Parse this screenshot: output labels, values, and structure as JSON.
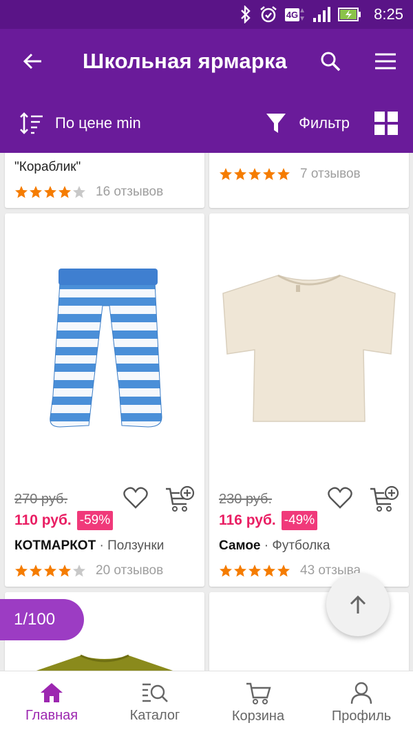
{
  "status_bar": {
    "time": "8:25",
    "network": "4G"
  },
  "app_bar": {
    "title": "Школьная ярмарка"
  },
  "sort_bar": {
    "sort_label": "По цене min",
    "filter_label": "Фильтр"
  },
  "products_partial": [
    {
      "title_line2": "\"Кораблик\"",
      "rating": 4,
      "reviews": "16 отзывов"
    },
    {
      "rating": 5,
      "reviews": "7 отзывов"
    }
  ],
  "products": [
    {
      "old_price": "270 руб.",
      "price": "110 руб.",
      "discount": "-59%",
      "brand": "КОТМАРКОТ",
      "category": "Ползунки",
      "rating": 4,
      "reviews": "20 отзывов"
    },
    {
      "old_price": "230 руб.",
      "price": "116 руб.",
      "discount": "-49%",
      "brand": "Самое",
      "category": "Футболка",
      "rating": 5,
      "reviews": "43 отзыва"
    }
  ],
  "counter": "1/100",
  "bottom_nav": [
    {
      "label": "Главная",
      "active": true
    },
    {
      "label": "Каталог",
      "active": false
    },
    {
      "label": "Корзина",
      "active": false
    },
    {
      "label": "Профиль",
      "active": false
    }
  ],
  "colors": {
    "primary": "#6a1b9a",
    "accent": "#9c27b0",
    "price": "#e91e63",
    "star": "#f57c00"
  }
}
